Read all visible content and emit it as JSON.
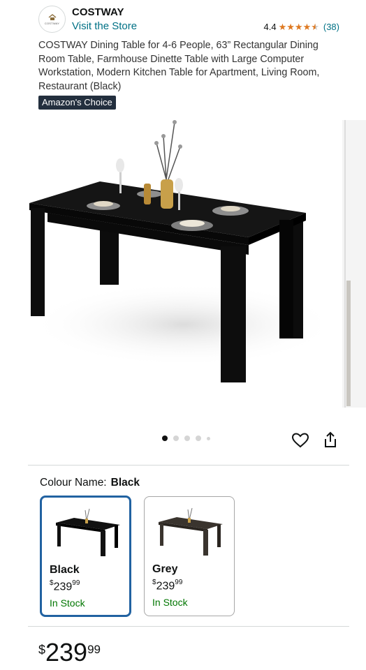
{
  "store": {
    "logo_text": "COSTWAY",
    "brand": "COSTWAY",
    "link": "Visit the Store"
  },
  "rating": {
    "value": "4.4",
    "count": "(38)",
    "stars": 4.4,
    "star_color": "#de7921"
  },
  "product": {
    "title": "COSTWAY Dining Table for 4-6 People, 63” Rectangular Dining Room Table, Farmhouse Dinette Table with Large Computer Workstation, Modern Kitchen Table for Apartment, Living Room, Restaurant (Black)",
    "badge": "Amazon's Choice"
  },
  "gallery": {
    "image_count": 5,
    "active_index": 0
  },
  "actions": {
    "favorite_icon": "heart-icon",
    "share_icon": "share-icon"
  },
  "variant": {
    "label": "Colour Name:",
    "selected": "Black",
    "options": [
      {
        "name": "Black",
        "price_symbol": "$",
        "price_whole": "239",
        "price_fraction": "99",
        "stock": "In Stock",
        "selected": true,
        "table_color": "#111111"
      },
      {
        "name": "Grey",
        "price_symbol": "$",
        "price_whole": "239",
        "price_fraction": "99",
        "stock": "In Stock",
        "selected": false,
        "table_color": "#3a342e"
      }
    ]
  },
  "price": {
    "symbol": "$",
    "whole": "239",
    "fraction": "99"
  },
  "colors": {
    "link": "#007185",
    "stock": "#007600",
    "selected_border": "#2162a1",
    "badge_bg": "#232f3e"
  }
}
